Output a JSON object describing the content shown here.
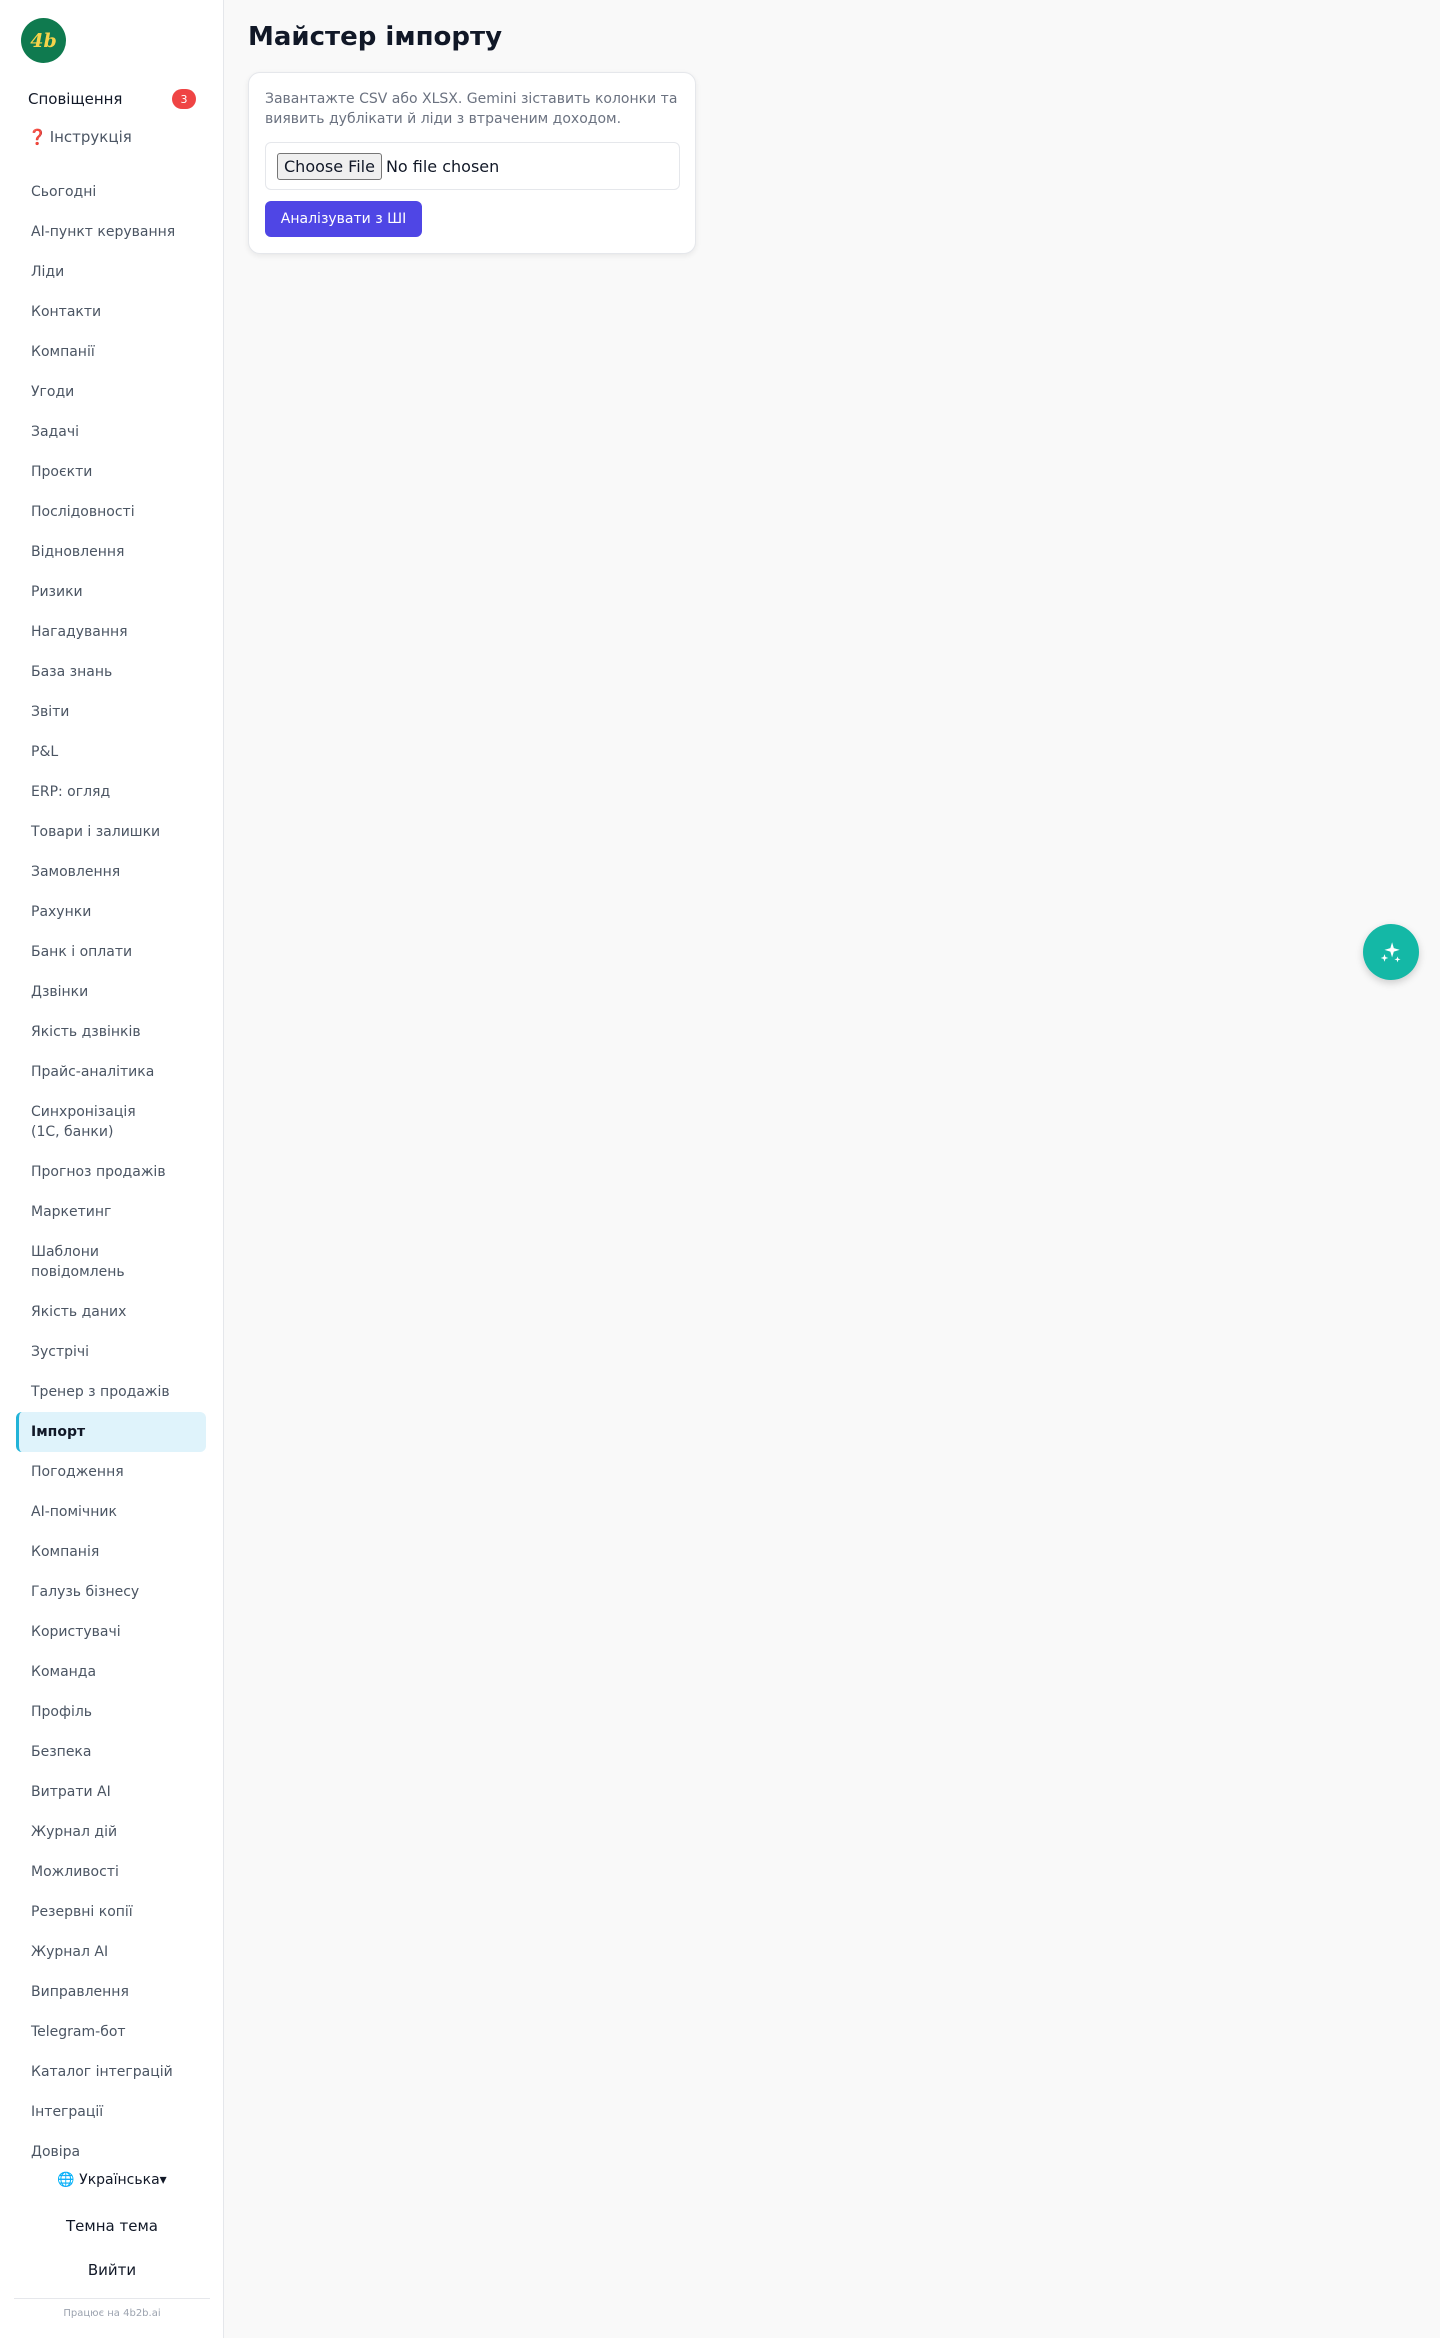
{
  "app": {
    "logo_text": "4b"
  },
  "sidebar": {
    "notifications_label": "Сповіщення",
    "notifications_count": "3",
    "guide_icon": "❓",
    "guide_label": "Інструкція",
    "items": [
      {
        "label": "Сьогодні"
      },
      {
        "label": "AI-пункт керування"
      },
      {
        "label": "Ліди"
      },
      {
        "label": "Контакти"
      },
      {
        "label": "Компанії"
      },
      {
        "label": "Угоди"
      },
      {
        "label": "Задачі"
      },
      {
        "label": "Проєкти"
      },
      {
        "label": "Послідовності"
      },
      {
        "label": "Відновлення"
      },
      {
        "label": "Ризики"
      },
      {
        "label": "Нагадування"
      },
      {
        "label": "База знань"
      },
      {
        "label": "Звіти"
      },
      {
        "label": "P&L"
      },
      {
        "label": "ERP: огляд"
      },
      {
        "label": "Товари і залишки"
      },
      {
        "label": "Замовлення"
      },
      {
        "label": "Рахунки"
      },
      {
        "label": "Банк і оплати"
      },
      {
        "label": "Дзвінки"
      },
      {
        "label": "Якість дзвінків"
      },
      {
        "label": "Прайс-аналітика"
      },
      {
        "label": "Синхронізація (1С, банки)"
      },
      {
        "label": "Прогноз продажів"
      },
      {
        "label": "Маркетинг"
      },
      {
        "label": "Шаблони повідомлень"
      },
      {
        "label": "Якість даних"
      },
      {
        "label": "Зустрічі"
      },
      {
        "label": "Тренер з продажів"
      },
      {
        "label": "Імпорт",
        "active": true
      },
      {
        "label": "Погодження"
      },
      {
        "label": "AI-помічник"
      },
      {
        "label": "Компанія"
      },
      {
        "label": "Галузь бізнесу"
      },
      {
        "label": "Користувачі"
      },
      {
        "label": "Команда"
      },
      {
        "label": "Профіль"
      },
      {
        "label": "Безпека"
      },
      {
        "label": "Витрати AI"
      },
      {
        "label": "Журнал дій"
      },
      {
        "label": "Можливості"
      },
      {
        "label": "Резервні копії"
      },
      {
        "label": "Журнал AI"
      },
      {
        "label": "Виправлення"
      },
      {
        "label": "Telegram-бот"
      },
      {
        "label": "Каталог інтеграцій"
      },
      {
        "label": "Інтеграції"
      },
      {
        "label": "Довіра"
      }
    ],
    "language_label": "🌐 Українська▾",
    "theme_label": "Темна тема",
    "logout_label": "Вийти",
    "powered_by": "Працює на 4b2b.ai"
  },
  "main": {
    "title": "Майстер імпорту",
    "description": "Завантажте CSV або XLSX. Gemini зіставить колонки та виявить дублікати й ліди з втраченим доходом.",
    "file_button_label": "Choose File",
    "file_status": "No file chosen",
    "analyze_button_label": "Аналізувати з ШІ"
  },
  "fab": {
    "icon": "sparkles-icon"
  },
  "colors": {
    "accent": "#4f46e5",
    "fab": "#14b8a6",
    "badge": "#ef4444",
    "active_bg": "#dff3fb",
    "active_border": "#22b3d8",
    "logo_bg": "#0f7a4f",
    "logo_text": "#f5d34a"
  }
}
